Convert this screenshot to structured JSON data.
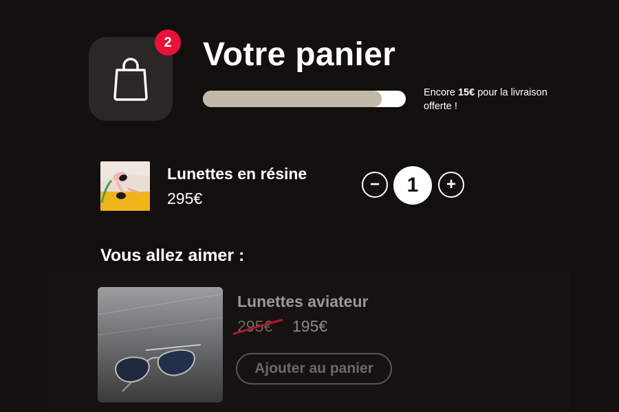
{
  "header": {
    "title": "Votre panier",
    "cart_badge_count": "2",
    "cart_icon": "shopping-bag-icon"
  },
  "shipping": {
    "progress_fraction": 0.88,
    "note_prefix": "Encore ",
    "note_amount": "15€",
    "note_suffix": " pour la livraison offerte !"
  },
  "cart_item": {
    "name": "Lunettes en résine",
    "price": "295€",
    "quantity": "1",
    "decrement_label": "−",
    "increment_label": "+"
  },
  "recommendations": {
    "heading": "Vous allez aimer :",
    "item": {
      "name": "Lunettes aviateur",
      "old_price": "295€",
      "new_price": "195€",
      "add_label": "Ajouter au panier"
    }
  },
  "colors": {
    "background": "#130f0e",
    "badge": "#e8123b",
    "progress_fill": "#c2baa8",
    "strike": "#b0182e"
  }
}
